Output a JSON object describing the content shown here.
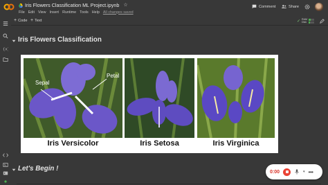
{
  "header": {
    "notebook_title": "Iris Flowers Classification ML Project.ipynb",
    "menu": [
      "File",
      "Edit",
      "View",
      "Insert",
      "Runtime",
      "Tools",
      "Help"
    ],
    "save_status": "All changes saved",
    "comment_label": "Comment",
    "share_label": "Share"
  },
  "toolbar": {
    "code_label": "Code",
    "text_label": "Text",
    "ram_label": "RAM",
    "disk_label": "Disk",
    "ram_usage": 0.35,
    "disk_usage": 0.2
  },
  "sections": [
    {
      "title": "Iris Flowers Classification"
    },
    {
      "title": "Let's Begin !"
    }
  ],
  "banner": {
    "captions": [
      "Iris Versicolor",
      "Iris Setosa",
      "Iris Virginica"
    ],
    "annotations": {
      "sepal": "Sepal",
      "petal": "Petal"
    }
  },
  "recorder": {
    "time": "0:00"
  },
  "colors": {
    "background": "#383838",
    "accent_orange": "#f9ab00",
    "record_red": "#ea4335",
    "flower_purple": "#6b57c8"
  }
}
